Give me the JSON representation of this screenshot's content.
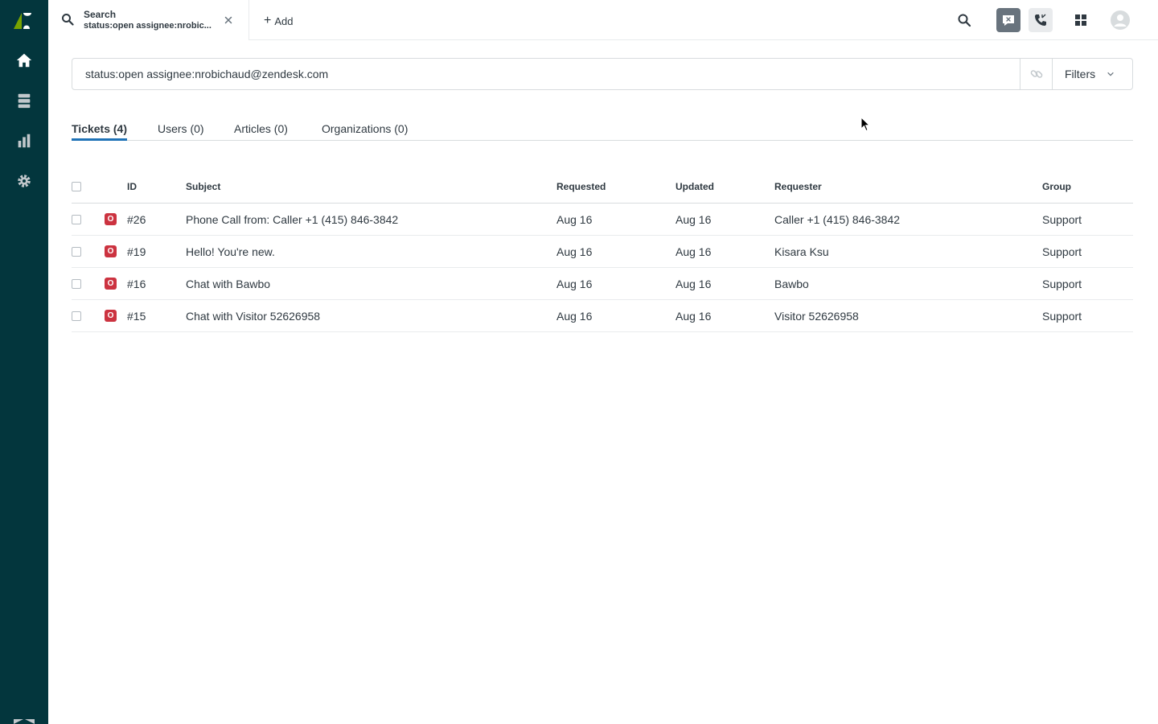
{
  "nav": {
    "items": [
      "home",
      "views",
      "reporting",
      "admin"
    ]
  },
  "topbar": {
    "tab": {
      "title": "Search",
      "subtitle": "status:open assignee:nrobic..."
    },
    "add_label": "Add"
  },
  "search": {
    "query": "status:open assignee:nrobichaud@zendesk.com",
    "filters_label": "Filters"
  },
  "result_tabs": [
    {
      "label": "Tickets (4)",
      "active": true
    },
    {
      "label": "Users (0)",
      "active": false
    },
    {
      "label": "Articles (0)",
      "active": false
    },
    {
      "label": "Organizations (0)",
      "active": false
    }
  ],
  "table": {
    "headers": {
      "id": "ID",
      "subject": "Subject",
      "requested": "Requested",
      "updated": "Updated",
      "requester": "Requester",
      "group": "Group"
    },
    "rows": [
      {
        "status": "O",
        "id": "#26",
        "subject": "Phone Call from: Caller +1 (415) 846-3842",
        "requested": "Aug 16",
        "updated": "Aug 16",
        "requester": "Caller +1 (415) 846-3842",
        "group": "Support"
      },
      {
        "status": "O",
        "id": "#19",
        "subject": "Hello! You're new.",
        "requested": "Aug 16",
        "updated": "Aug 16",
        "requester": "Kisara Ksu",
        "group": "Support"
      },
      {
        "status": "O",
        "id": "#16",
        "subject": "Chat with Bawbo",
        "requested": "Aug 16",
        "updated": "Aug 16",
        "requester": "Bawbo",
        "group": "Support"
      },
      {
        "status": "O",
        "id": "#15",
        "subject": "Chat with Visitor 52626958",
        "requested": "Aug 16",
        "updated": "Aug 16",
        "requester": "Visitor 52626958",
        "group": "Support"
      }
    ]
  },
  "colors": {
    "nav_bg": "#03363d",
    "accent": "#1f73b7",
    "status_open": "#cc3340"
  }
}
